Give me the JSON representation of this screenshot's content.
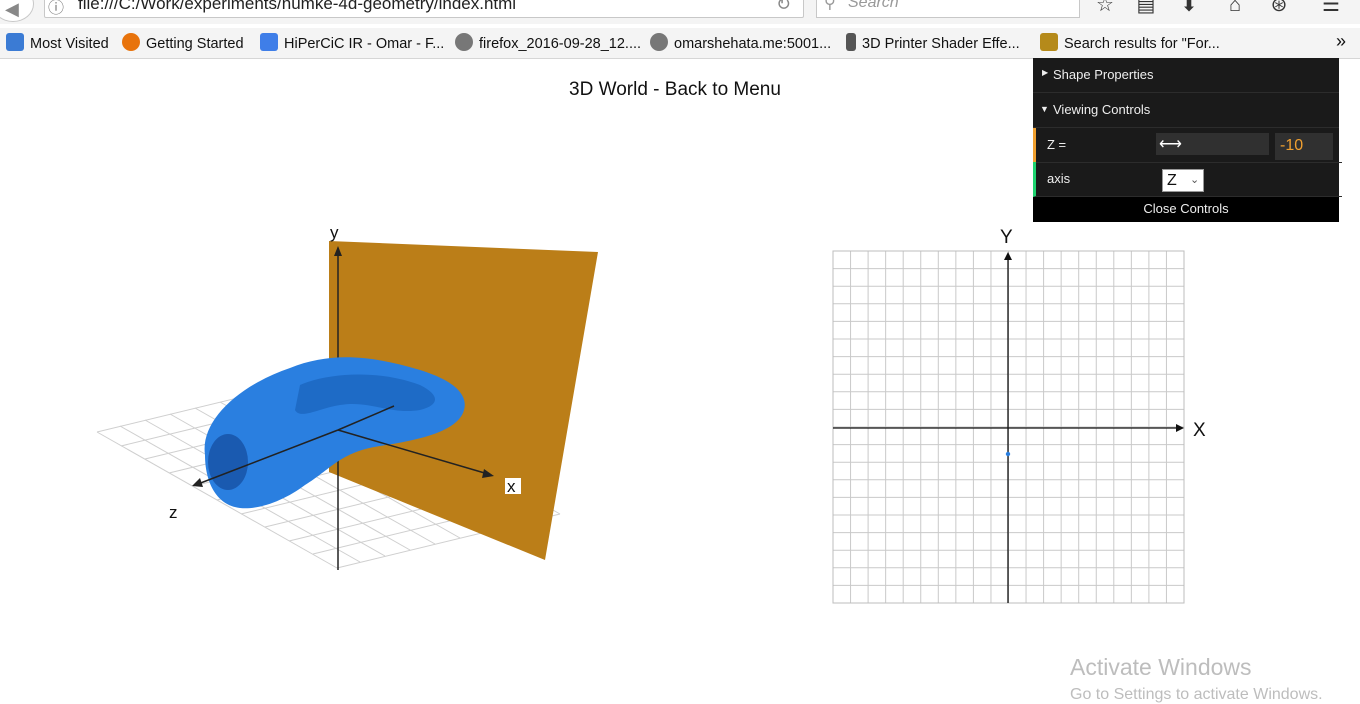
{
  "browser": {
    "url": "file:///C:/Work/experiments/numke-4d-geometry/index.html",
    "search_placeholder": "Search",
    "bookmarks": [
      {
        "label": "Most Visited",
        "color": "#3b7bd4"
      },
      {
        "label": "Getting Started",
        "color": "#e8730c"
      },
      {
        "label": "HiPerCiC IR - Omar - F...",
        "color": "#3f7ee8"
      },
      {
        "label": "firefox_2016-09-28_12....",
        "color": "#777777"
      },
      {
        "label": "omarshehata.me:5001...",
        "color": "#777777"
      },
      {
        "label": "3D Printer Shader Effe...",
        "color": "#555555"
      },
      {
        "label": "Search results for \"For...",
        "color": "#b58a1a"
      }
    ],
    "overflow_label": "»"
  },
  "page": {
    "title": "3D World - Back to Menu"
  },
  "gui": {
    "shape_properties_label": "Shape Properties",
    "viewing_controls_label": "Viewing Controls",
    "z_label": "Z =",
    "z_value": "-10",
    "axis_label": "axis",
    "axis_value": "Z",
    "axis_options": [
      "Z"
    ],
    "close_label": "Close Controls",
    "accent_number": "#f0a030",
    "accent_select": "#2fa1d6",
    "accent_z": "#f0a030",
    "accent_axis": "#1ed36f"
  },
  "scene3d": {
    "axis_x": "x",
    "axis_y": "y",
    "axis_z": "z",
    "plane_color": "#bb7e18",
    "shape_color": "#2a7fe0"
  },
  "chart2d": {
    "axis_x": "X",
    "axis_y": "Y"
  },
  "watermark": {
    "line1": "Activate Windows",
    "line2": "Go to Settings to activate Windows."
  },
  "icons": [
    "back-arrow-icon",
    "info-icon",
    "reload-icon",
    "search-icon",
    "star-icon",
    "reading-list-icon",
    "download-icon",
    "home-icon",
    "pocket-icon",
    "menu-icon"
  ]
}
